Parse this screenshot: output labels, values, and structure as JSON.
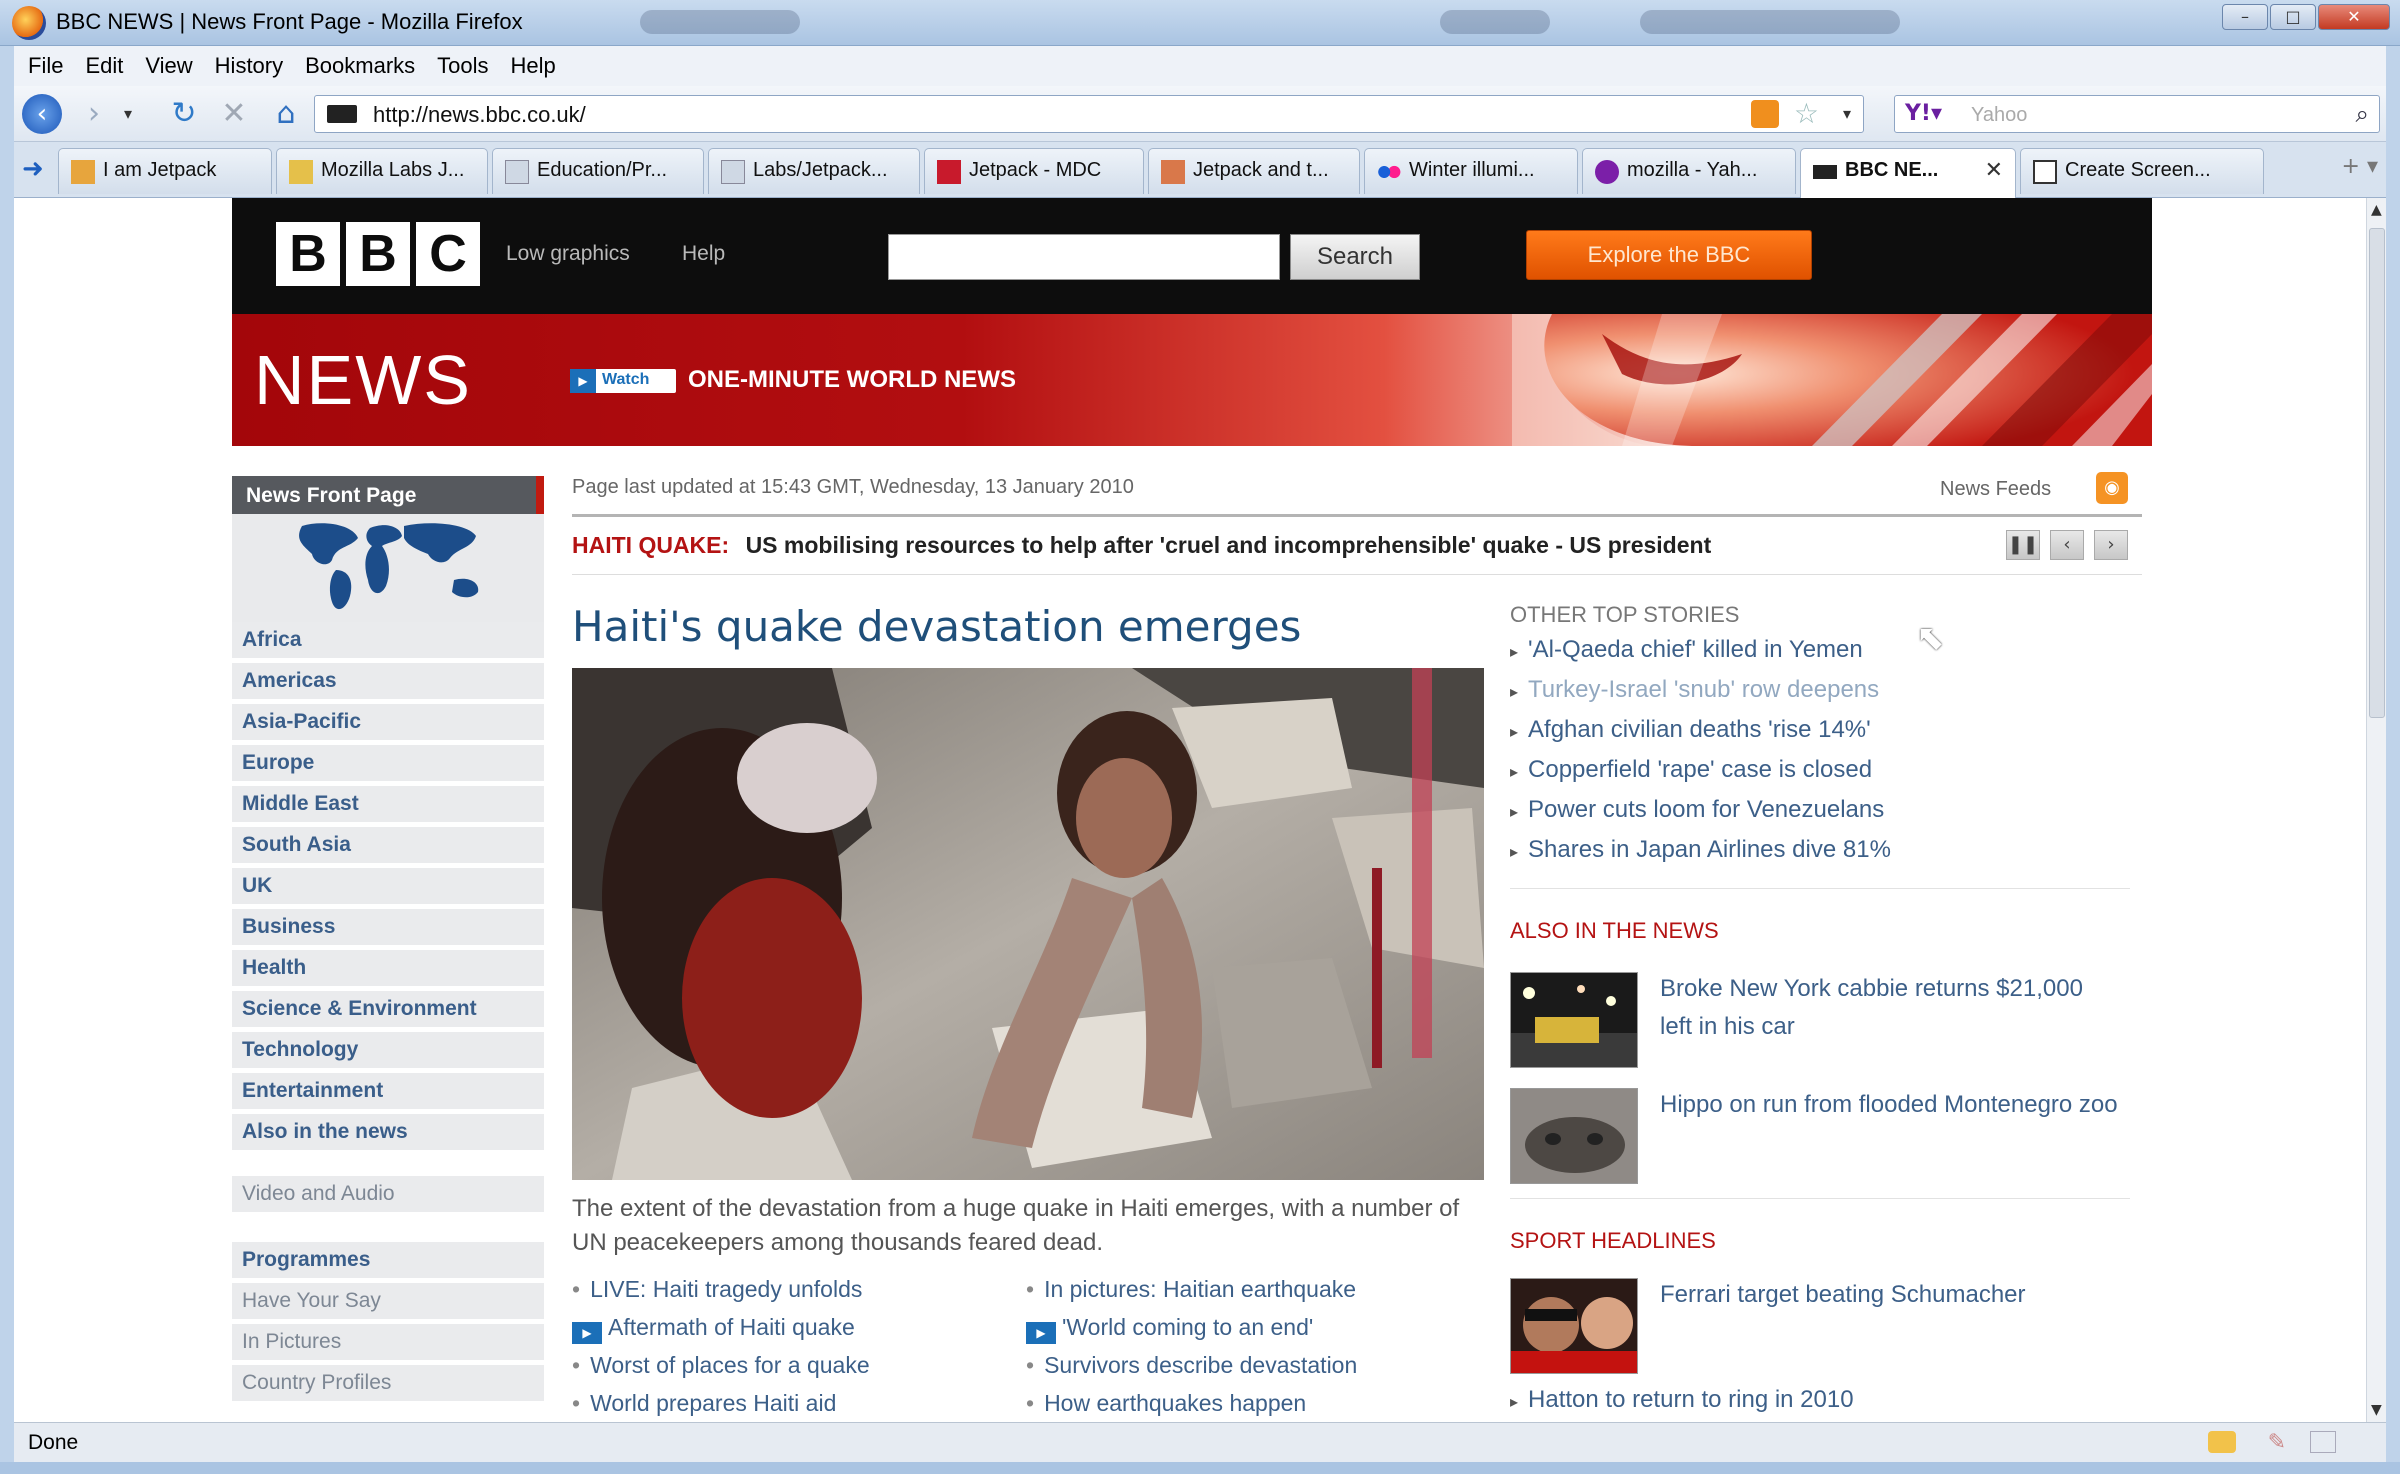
{
  "window": {
    "title": "BBC NEWS | News Front Page - Mozilla Firefox"
  },
  "menu": [
    "File",
    "Edit",
    "View",
    "History",
    "Bookmarks",
    "Tools",
    "Help"
  ],
  "navbar": {
    "url": "http://news.bbc.co.uk/",
    "search_placeholder": "Yahoo"
  },
  "tabs": [
    {
      "label": "I am Jetpack",
      "icon": "puzzle-icon"
    },
    {
      "label": "Mozilla Labs J...",
      "icon": "labs-icon"
    },
    {
      "label": "Education/Pr...",
      "icon": "page-icon"
    },
    {
      "label": "Labs/Jetpack...",
      "icon": "page-icon"
    },
    {
      "label": "Jetpack - MDC",
      "icon": "mdc-icon"
    },
    {
      "label": "Jetpack and t...",
      "icon": "page-icon"
    },
    {
      "label": "Winter illumi...",
      "icon": "flickr-icon"
    },
    {
      "label": "mozilla - Yah...",
      "icon": "yahoo-icon"
    },
    {
      "label": "BBC NE...",
      "icon": "bbc-icon",
      "active": true
    },
    {
      "label": "Create Screen...",
      "icon": "page-icon"
    }
  ],
  "status": {
    "text": "Done"
  },
  "bbc": {
    "logo": [
      "B",
      "B",
      "C"
    ],
    "low_graphics": "Low graphics",
    "help": "Help",
    "search_button": "Search",
    "explore": "Explore the BBC"
  },
  "banner": {
    "news": "NEWS",
    "watch": "Watch",
    "watch_title": "ONE-MINUTE WORLD NEWS"
  },
  "leftnav": {
    "head": "News Front Page",
    "regions": [
      "Africa",
      "Americas",
      "Asia-Pacific",
      "Europe",
      "Middle East",
      "South Asia",
      "UK",
      "Business",
      "Health",
      "Science & Environment",
      "Technology",
      "Entertainment",
      "Also in the news"
    ],
    "video": "Video and Audio",
    "programmes": "Programmes",
    "extras": [
      "Have Your Say",
      "In Pictures",
      "Country Profiles"
    ]
  },
  "main": {
    "updated": "Page last updated at 15:43 GMT, Wednesday, 13 January 2010",
    "feeds": "News Feeds",
    "ticker_label": "HAITI QUAKE:",
    "ticker_text": "US mobilising resources to help after 'cruel and incomprehensible' quake - US president",
    "headline": "Haiti's quake devastation emerges",
    "summary": "The extent of the devastation from a huge quake in Haiti emerges, with a number of UN peacekeepers among thousands feared dead.",
    "links_left": [
      "LIVE: Haiti tragedy unfolds",
      "Aftermath of Haiti quake",
      "Worst of places for a quake",
      "World prepares Haiti aid"
    ],
    "links_right": [
      "In pictures: Haitian earthquake",
      "'World coming to an end'",
      "Survivors describe devastation",
      "How earthquakes happen"
    ]
  },
  "right": {
    "other_head": "OTHER TOP STORIES",
    "other": [
      "'Al-Qaeda chief' killed in Yemen",
      "Turkey-Israel 'snub' row deepens",
      "Afghan civilian deaths 'rise 14%'",
      "Copperfield 'rape' case is closed",
      "Power cuts loom for Venezuelans",
      "Shares in Japan Airlines dive 81%"
    ],
    "also_head": "ALSO IN THE NEWS",
    "also1": "Broke New York cabbie returns $21,000 left in his car",
    "also2": "Hippo on run from flooded Montenegro zoo",
    "sport_head": "SPORT HEADLINES",
    "sport1": "Ferrari target beating Schumacher",
    "sport2": "Hatton to return to ring in 2010"
  }
}
